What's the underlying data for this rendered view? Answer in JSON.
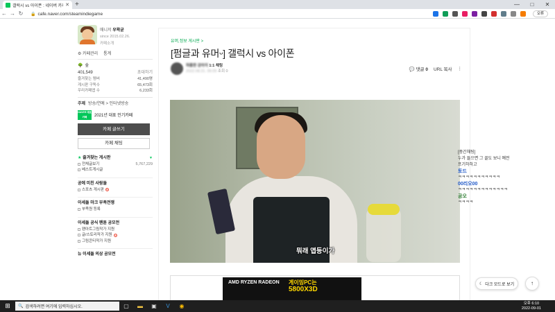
{
  "browser": {
    "tab_title": "갤럭시 vs 아이폰 : 네이버 카페",
    "new_tab": "+",
    "url": "cafe.naver.com/steamindiegame",
    "profile_label": "오류",
    "nav": {
      "back": "←",
      "forward": "→",
      "reload": "↻"
    },
    "window": {
      "minimize": "—",
      "maximize": "□",
      "close": "✕"
    }
  },
  "sidebar": {
    "manager_role": "매니저",
    "manager_name": "우왁굳",
    "since": "since 2015.02.26.",
    "cafe_intro": "카페소개",
    "manage": "⚙ 카페관리",
    "stats": "통계",
    "level": "숲",
    "members": "401,549",
    "invite": "초대하기",
    "stats_list": [
      {
        "label": "즐겨찾는 멤버",
        "value": "41,490명"
      },
      {
        "label": "게시판 구독수",
        "value": "65,473회"
      },
      {
        "label": "우리카페앱 수",
        "value": "6,233회"
      }
    ],
    "topic_label": "주제",
    "topic_value": "방송/연예 > 인터넷방송",
    "naver_badge": "NAVER 대표카페",
    "award": "2021년 대표 인기카페",
    "write_button": "카페 글쓰기",
    "chat_button": "카페 채팅",
    "fav_title": "즐겨찾는 게시판",
    "fav_toggle": "▼",
    "fav_items": [
      {
        "label": "전체글보기",
        "count": "5,767,229"
      },
      {
        "label": "베스트게시글",
        "count": ""
      }
    ],
    "section1": "공에 미친 사람들",
    "section1_items": [
      "스포츠 게시판"
    ],
    "section2": "이세돌 마크 부족전쟁",
    "section2_items": [
      "부족원 등록"
    ],
    "section3": "이세돌 공식 팬툰 공모전",
    "section3_items": [
      "팬아트그림작가 지원",
      "글/스토리작가 지원",
      "그림콘티작가 지원"
    ],
    "section4": "뉴 이세돌 의상 공모전"
  },
  "article": {
    "category": "유머,정보 게시판 >",
    "title": "[펌글과 유머ᵕ] 갤럭시 vs 아이폰",
    "author_name": "하품한 강아지",
    "author_rank": "1:1 채팅",
    "date": "2022.08.31. 06:09",
    "views": "조회 0",
    "comments_label": "댓글",
    "comments_count": "0",
    "url_copy": "URL 복사",
    "more": "⋮",
    "video_subtitle": "뭐래 앱등이가",
    "ad_brand": "AMD RYZEN RADEON",
    "ad_line1": "게이밍PC는",
    "ad_line2": "5800X3D"
  },
  "chat_overlay": {
    "lines": [
      {
        "type": "text",
        "text": "[중간채팅]"
      },
      {
        "type": "text",
        "text": "누가 들으면 그 꼴도 보니 예전"
      },
      {
        "type": "text",
        "text": "프기하하고"
      },
      {
        "type": "name",
        "text": "토드"
      },
      {
        "type": "text",
        "text": "ㅋㅋㅋㅋㅋㅋㅋㅋㅋㅋㅋ"
      },
      {
        "type": "name",
        "text": "00리오00"
      },
      {
        "type": "text",
        "text": "ㅋㅋㅋㅋㅋㅋㅋㅋㅋㅋㅋㅋㅋ"
      },
      {
        "type": "name",
        "text": "공오"
      },
      {
        "type": "text",
        "text": "ㅋㅋㅋㅋ"
      }
    ]
  },
  "floating": {
    "darkmode": "다크 모드로 보기",
    "top": "↑"
  },
  "taskbar": {
    "search_placeholder": "검색하려면 여기에 입력하십시오.",
    "time": "오후 6:10",
    "date": "2022-09-01"
  }
}
